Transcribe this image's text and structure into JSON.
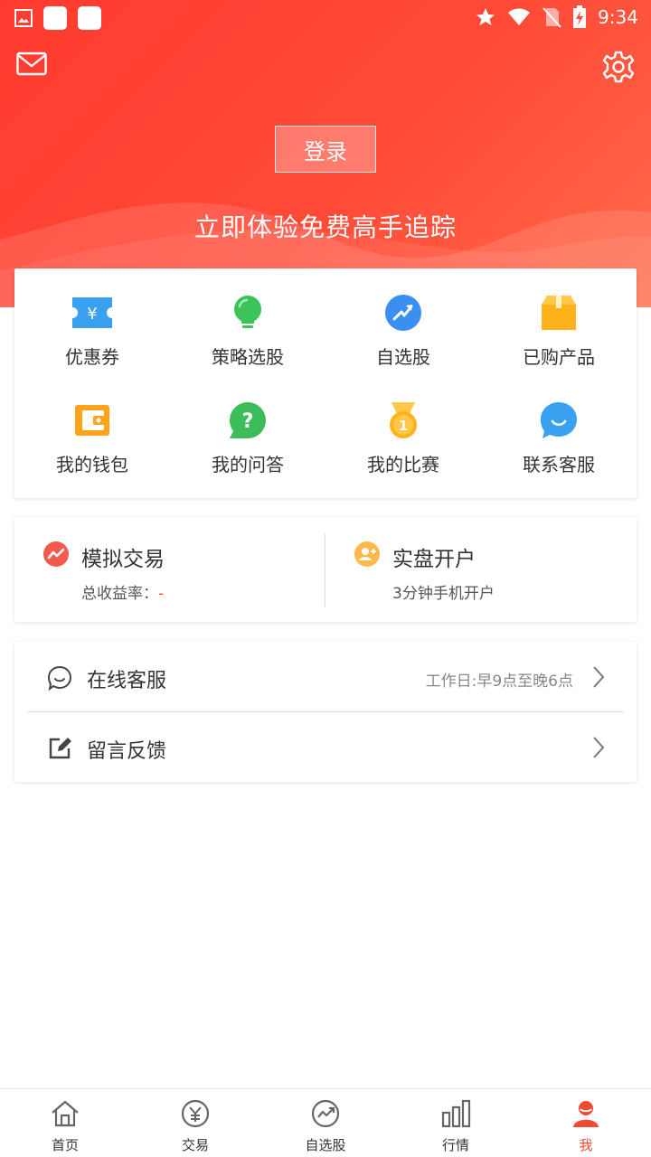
{
  "status_bar": {
    "time": "9:34"
  },
  "header": {
    "login_label": "登录",
    "slogan": "立即体验免费高手追踪"
  },
  "shortcuts": [
    {
      "label": "优惠券",
      "icon": "coupon-icon",
      "color": "#3aa0f0"
    },
    {
      "label": "策略选股",
      "icon": "lightbulb-icon",
      "color": "#3cc35a"
    },
    {
      "label": "自选股",
      "icon": "trend-arrow-icon",
      "color": "#3a8ff0"
    },
    {
      "label": "已购产品",
      "icon": "box-icon",
      "color": "#ffb31a"
    },
    {
      "label": "我的钱包",
      "icon": "wallet-icon",
      "color": "#ffa31a"
    },
    {
      "label": "我的问答",
      "icon": "question-bubble-icon",
      "color": "#3cbd5a"
    },
    {
      "label": "我的比赛",
      "icon": "medal-icon",
      "color": "#ffb31a"
    },
    {
      "label": "联系客服",
      "icon": "chat-bubble-icon",
      "color": "#3aa0f0"
    }
  ],
  "trade": {
    "simulated": {
      "title": "模拟交易",
      "sub_label": "总收益率：",
      "sub_value": "-"
    },
    "real": {
      "title": "实盘开户",
      "sub_label": "3分钟手机开户"
    }
  },
  "service": {
    "online": {
      "label": "在线客服",
      "note": "工作日:早9点至晚6点"
    },
    "feedback": {
      "label": "留言反馈"
    }
  },
  "tabs": [
    {
      "label": "首页",
      "icon": "home-icon"
    },
    {
      "label": "交易",
      "icon": "yen-circle-icon"
    },
    {
      "label": "自选股",
      "icon": "trend-circle-icon"
    },
    {
      "label": "行情",
      "icon": "bar-chart-icon"
    },
    {
      "label": "我",
      "icon": "person-icon",
      "active": true
    }
  ],
  "colors": {
    "brand": "#f04a35",
    "hero": "#ff3b2f"
  }
}
